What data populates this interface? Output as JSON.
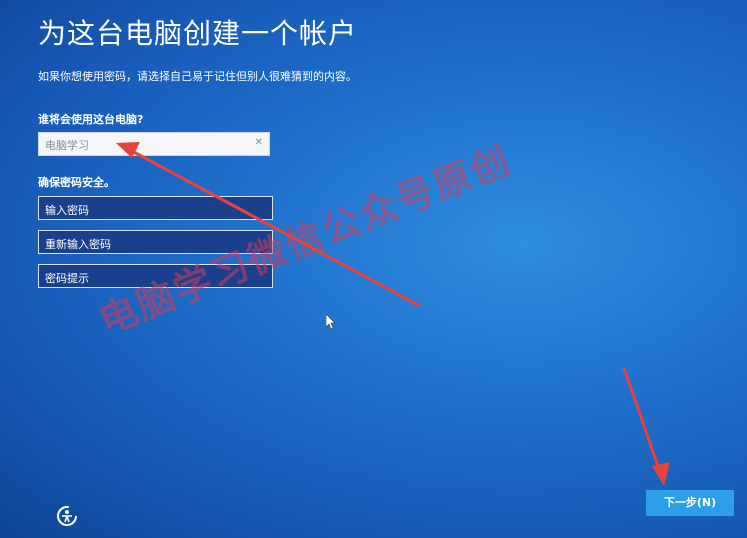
{
  "title": "为这台电脑创建一个帐户",
  "subtitle": "如果你想使用密码，请选择自己易于记住但别人很难猜到的内容。",
  "who_label": "谁将会使用这台电脑?",
  "username": {
    "value": "电脑学习"
  },
  "secure_label": "确保密码安全。",
  "password_placeholder": "输入密码",
  "reenter_placeholder": "重新输入密码",
  "hint_placeholder": "密码提示",
  "next_label": "下一步(N)",
  "watermark": "电脑学习微信公众号原创",
  "icons": {
    "clear": "clear-icon",
    "ease_of_access": "ease-of-access-icon"
  },
  "colors": {
    "background": "#1f6fcc",
    "field_bg": "#1a3f8c",
    "button": "#2d9fe8",
    "annotation": "#e8433a"
  }
}
